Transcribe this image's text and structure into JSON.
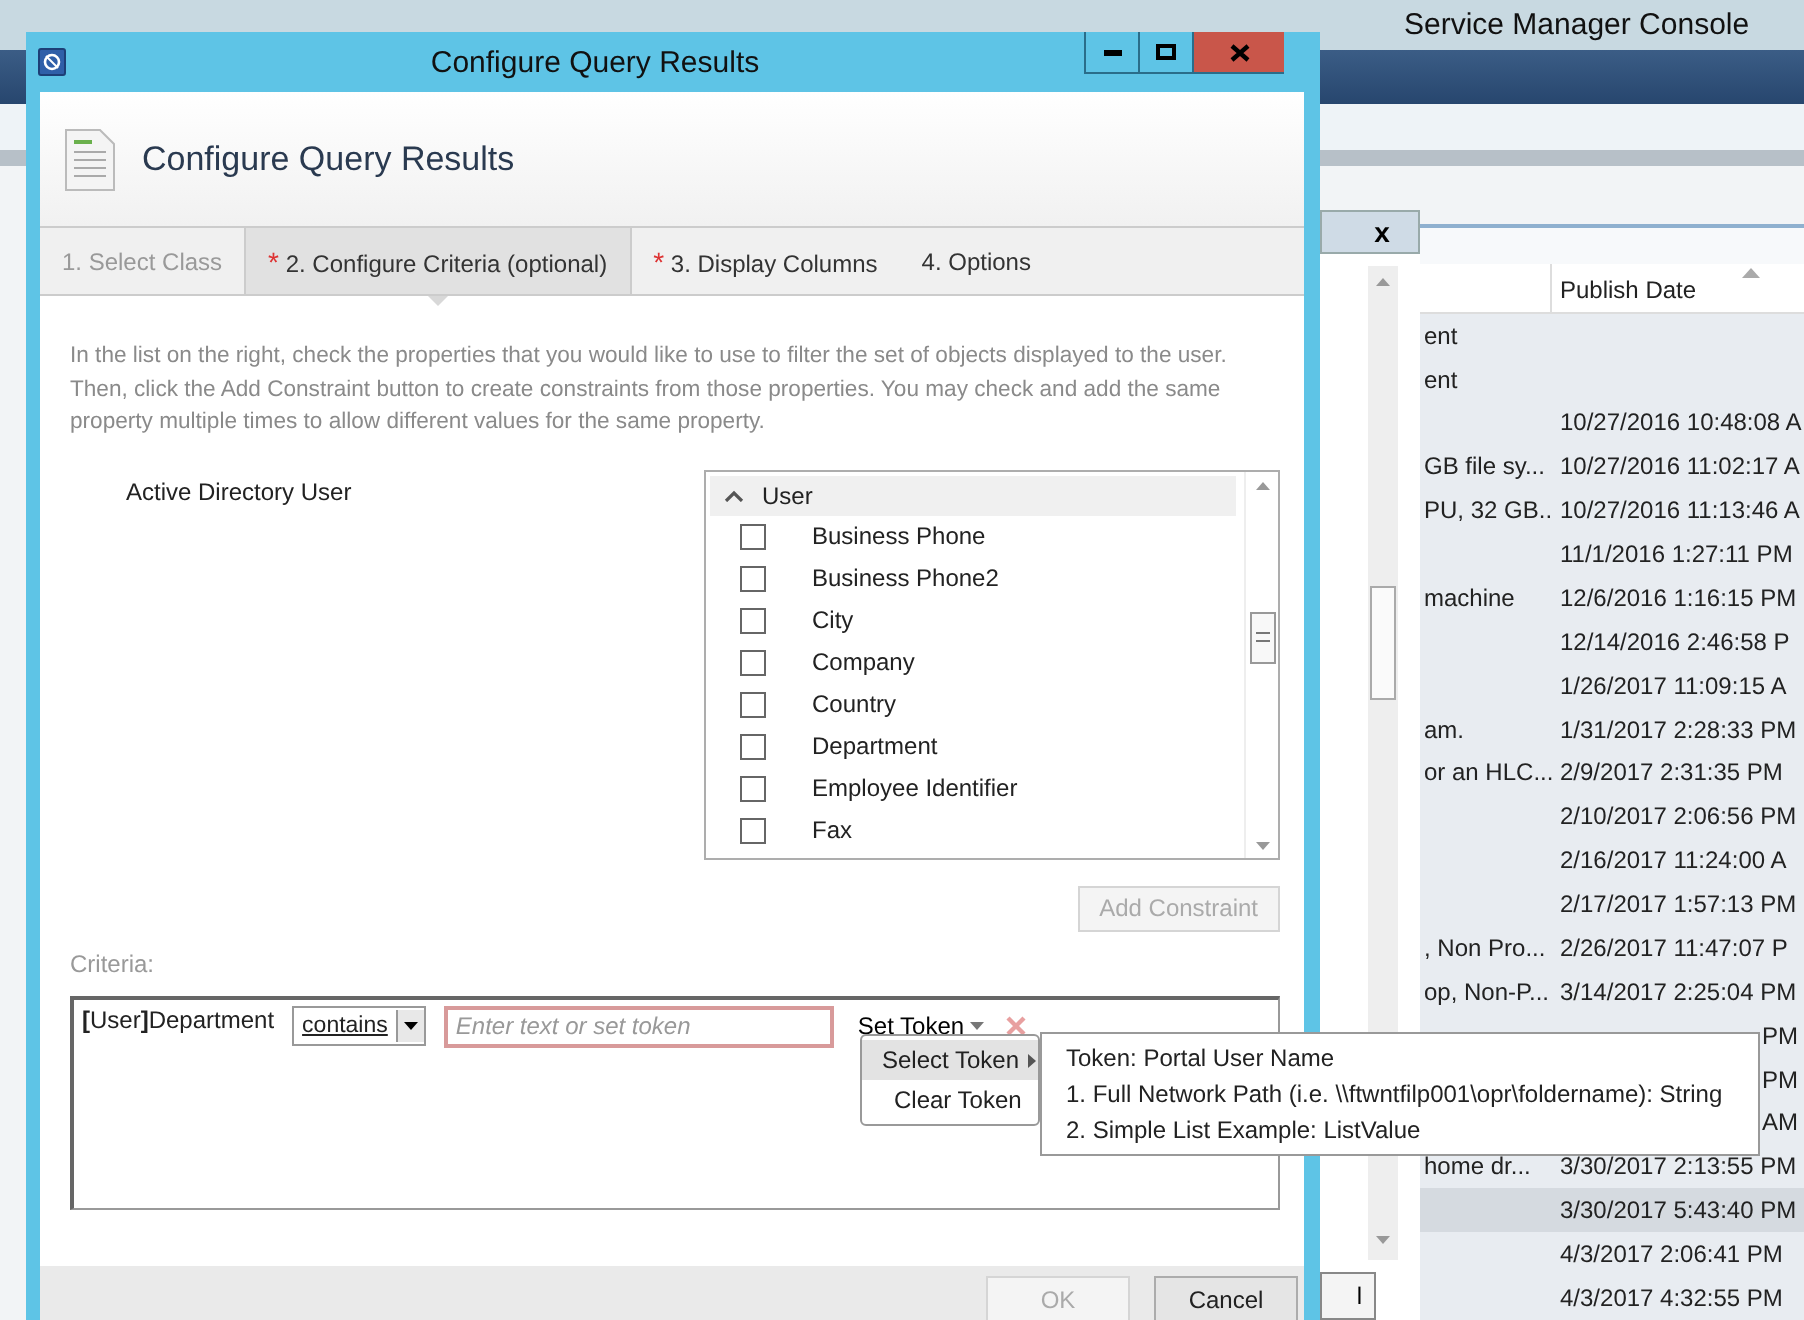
{
  "console": {
    "title": "Service Manager Console",
    "pane_close": "x",
    "pane_button": "l",
    "list": {
      "columns": [
        {
          "sorted": false
        },
        {
          "label": "Publish Date",
          "sorted": true
        }
      ],
      "rows": [
        {
          "column_1": "ent",
          "publish_date": "",
          "selected": false,
          "occluded": false
        },
        {
          "column_1": "ent",
          "publish_date": "",
          "selected": false,
          "occluded": false
        },
        {
          "column_1": "",
          "publish_date": "10/27/2016 10:48:08 A",
          "selected": false,
          "occluded": false
        },
        {
          "column_1": " GB file sy...",
          "publish_date": "10/27/2016 11:02:17 A",
          "selected": false,
          "occluded": false
        },
        {
          "column_1": "PU, 32 GB...",
          "publish_date": "10/27/2016 11:13:46 A",
          "selected": false,
          "occluded": false
        },
        {
          "column_1": "",
          "publish_date": "11/1/2016 1:27:11 PM",
          "selected": false,
          "occluded": false
        },
        {
          "column_1": " machine",
          "publish_date": "12/6/2016 1:16:15 PM",
          "selected": false,
          "occluded": false
        },
        {
          "column_1": "",
          "publish_date": "12/14/2016 2:46:58 P",
          "selected": false,
          "occluded": false
        },
        {
          "column_1": "",
          "publish_date": "1/26/2017 11:09:15 A",
          "selected": false,
          "occluded": false
        },
        {
          "column_1": "am.",
          "publish_date": "1/31/2017 2:28:33 PM",
          "selected": false,
          "occluded": false
        },
        {
          "column_1": "or an HLC...",
          "publish_date": "2/9/2017 2:31:35 PM",
          "selected": false,
          "occluded": false
        },
        {
          "column_1": "",
          "publish_date": "2/10/2017 2:06:56 PM",
          "selected": false,
          "occluded": false
        },
        {
          "column_1": "",
          "publish_date": "2/16/2017 11:24:00 A",
          "selected": false,
          "occluded": false
        },
        {
          "column_1": "",
          "publish_date": "2/17/2017 1:57:13 PM",
          "selected": false,
          "occluded": false
        },
        {
          "column_1": ", Non Pro...",
          "publish_date": "2/26/2017 11:47:07 P",
          "selected": false,
          "occluded": false
        },
        {
          "column_1": "op, Non-P...",
          "publish_date": "3/14/2017 2:25:04 PM",
          "selected": false,
          "occluded": false
        },
        {
          "column_1": "",
          "publish_date": "PM",
          "selected": false,
          "occluded": true
        },
        {
          "column_1": "",
          "publish_date": "PM",
          "selected": false,
          "occluded": true
        },
        {
          "column_1": "",
          "publish_date": "AM",
          "selected": false,
          "occluded": true
        },
        {
          "column_1": "home dr...",
          "publish_date": "3/30/2017 2:13:55 PM",
          "selected": false,
          "occluded": false
        },
        {
          "column_1": "",
          "publish_date": "3/30/2017 5:43:40 PM",
          "selected": true,
          "occluded": false
        },
        {
          "column_1": "",
          "publish_date": "4/3/2017 2:06:41 PM",
          "selected": false,
          "occluded": false
        },
        {
          "column_1": "",
          "publish_date": "4/3/2017 4:32:55 PM",
          "selected": false,
          "occluded": false
        }
      ]
    }
  },
  "dialog": {
    "title": "Configure Query Results",
    "header": "Configure Query Results",
    "tabs": [
      {
        "label": "1. Select Class",
        "required": false,
        "selected": false,
        "disabled": true
      },
      {
        "label": "2. Configure Criteria (optional)",
        "required": true,
        "selected": true,
        "disabled": false
      },
      {
        "label": "3. Display Columns",
        "required": true,
        "selected": false,
        "disabled": false
      },
      {
        "label": "4. Options",
        "required": false,
        "selected": false,
        "disabled": false
      }
    ],
    "required_mark": "*",
    "instructions": "In the list on the right, check the properties that you would like to use to filter the set of objects displayed to the user. Then, click the Add Constraint button to create constraints from those properties. You may check and add the same property multiple times to allow different values for the same property.",
    "class_label": "Active Directory User",
    "property_list": {
      "group": "User",
      "expanded": true,
      "items": [
        {
          "label": "Business Phone",
          "checked": false
        },
        {
          "label": "Business Phone2",
          "checked": false
        },
        {
          "label": "City",
          "checked": false
        },
        {
          "label": "Company",
          "checked": false
        },
        {
          "label": "Country",
          "checked": false
        },
        {
          "label": "Department",
          "checked": false
        },
        {
          "label": "Employee Identifier",
          "checked": false
        },
        {
          "label": "Fax",
          "checked": false
        }
      ]
    },
    "add_constraint": {
      "label": "Add Constraint",
      "disabled": true
    },
    "criteria_label": "Criteria:",
    "criterion": {
      "property": "**[**User**]**Department",
      "operator": "contains",
      "value_placeholder": "Enter text or set token",
      "invalid": true,
      "token_button": "Set Token"
    },
    "token_menu": [
      {
        "label": "Select Token",
        "submenu": true,
        "selected": true
      },
      {
        "label": "Clear Token",
        "submenu": false,
        "selected": false
      }
    ],
    "token_submenu": [
      "Token: Portal User Name",
      "1. Full Network Path (i.e. \\\\ftwntfilp001\\opr\\foldername): String",
      "2. Simple List Example: ListValue"
    ],
    "buttons": [
      {
        "label": "OK",
        "disabled": true
      },
      {
        "label": "Cancel",
        "disabled": false
      }
    ]
  }
}
